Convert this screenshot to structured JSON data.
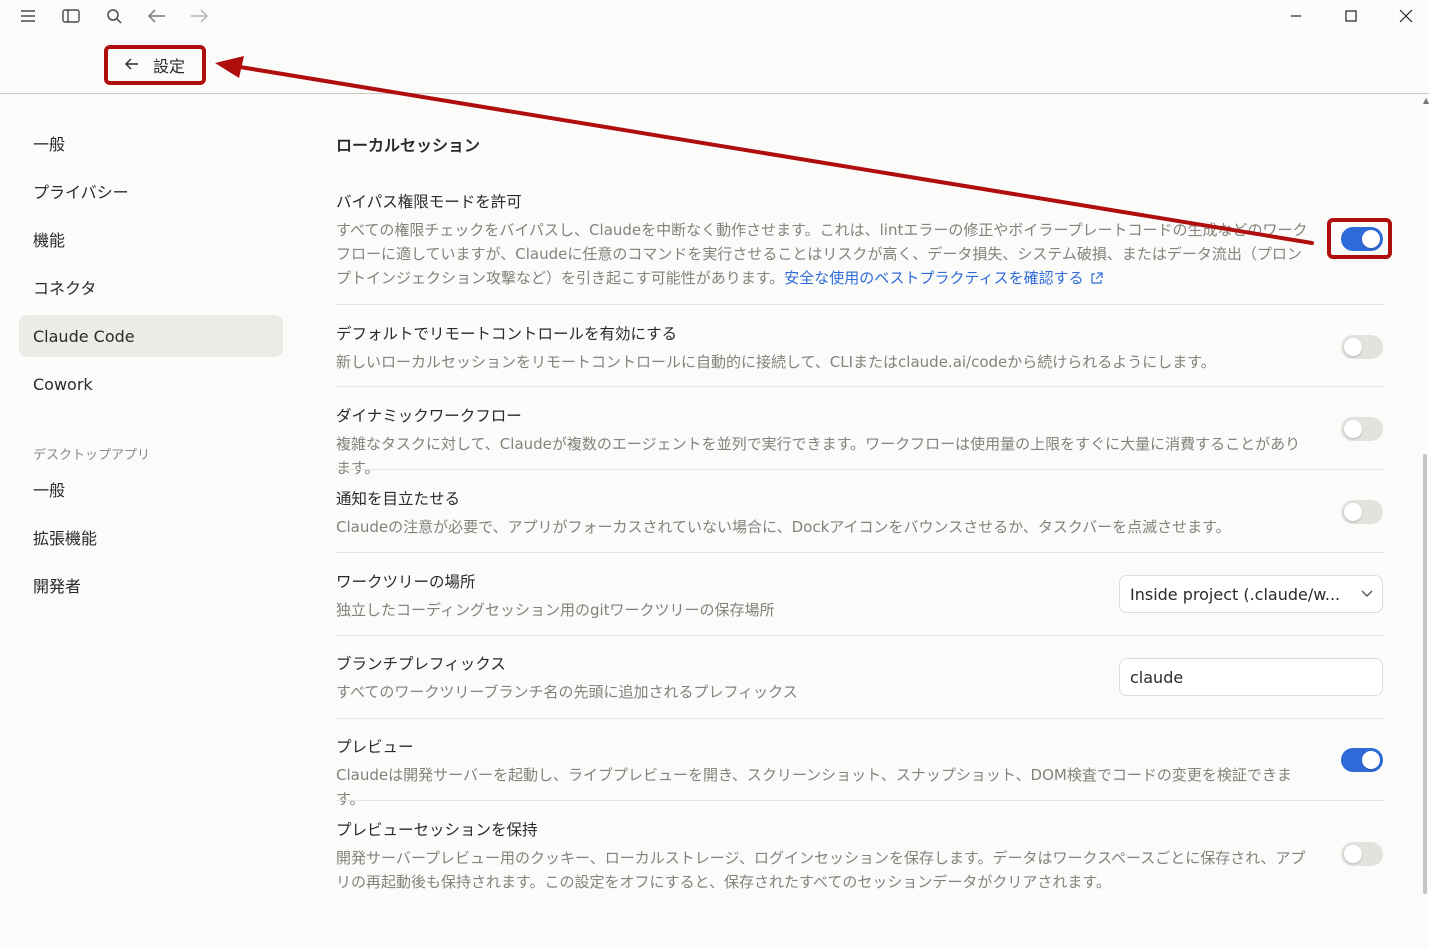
{
  "header": {
    "back_label": "設定"
  },
  "sidebar": {
    "items": [
      {
        "label": "一般"
      },
      {
        "label": "プライバシー"
      },
      {
        "label": "機能"
      },
      {
        "label": "コネクタ"
      },
      {
        "label": "Claude Code",
        "active": true
      },
      {
        "label": "Cowork"
      }
    ],
    "section_label": "デスクトップアプリ",
    "section_items": [
      {
        "label": "一般"
      },
      {
        "label": "拡張機能"
      },
      {
        "label": "開発者"
      }
    ]
  },
  "main": {
    "section_title": "ローカルセッション",
    "settings": [
      {
        "title": "バイパス権限モードを許可",
        "desc": "すべての権限チェックをバイパスし、Claudeを中断なく動作させます。これは、lintエラーの修正やボイラープレートコードの生成などのワークフローに適していますが、Claudeに任意のコマンドを実行させることはリスクが高く、データ損失、システム破損、またはデータ流出（プロンプトインジェクション攻撃など）を引き起こす可能性があります。",
        "link": "安全な使用のベストプラクティスを確認する",
        "enabled": true
      },
      {
        "title": "デフォルトでリモートコントロールを有効にする",
        "desc": "新しいローカルセッションをリモートコントロールに自動的に接続して、CLIまたはclaude.ai/codeから続けられるようにします。",
        "enabled": false
      },
      {
        "title": "ダイナミックワークフロー",
        "desc": "複雑なタスクに対して、Claudeが複数のエージェントを並列で実行できます。ワークフローは使用量の上限をすぐに大量に消費することがあります。",
        "enabled": false
      },
      {
        "title": "通知を目立たせる",
        "desc": "Claudeの注意が必要で、アプリがフォーカスされていない場合に、Dockアイコンをバウンスさせるか、タスクバーを点滅させます。",
        "enabled": false
      },
      {
        "title": "ワークツリーの場所",
        "desc": "独立したコーディングセッション用のgitワークツリーの保存場所",
        "select_value": "Inside project (.claude/w..."
      },
      {
        "title": "ブランチプレフィックス",
        "desc": "すべてのワークツリーブランチ名の先頭に追加されるプレフィックス",
        "input_value": "claude"
      },
      {
        "title": "プレビュー",
        "desc": "Claudeは開発サーバーを起動し、ライブプレビューを開き、スクリーンショット、スナップショット、DOM検査でコードの変更を検証できます。",
        "enabled": true
      },
      {
        "title": "プレビューセッションを保持",
        "desc": "開発サーバープレビュー用のクッキー、ローカルストレージ、ログインセッションを保存します。データはワークスペースごとに保存され、アプリの再起動後も保持されます。この設定をオフにすると、保存されたすべてのセッションデータがクリアされます。",
        "enabled": false
      }
    ]
  },
  "colors": {
    "accent": "#2f6bd8",
    "annotation": "#b00d0d",
    "active_nav_bg": "#ecebe7"
  }
}
